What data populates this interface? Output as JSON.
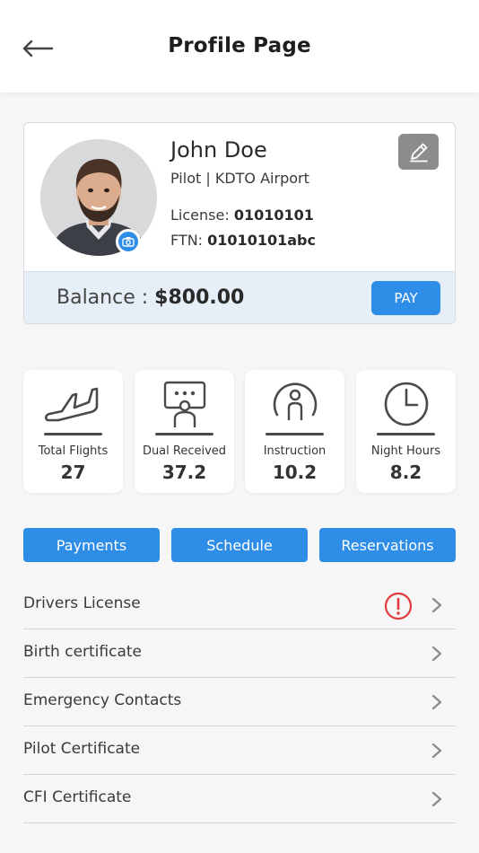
{
  "header": {
    "title": "Profile Page",
    "back_icon": "back-arrow-icon"
  },
  "profile": {
    "name": "John Doe",
    "role": "Pilot |",
    "airport": "KDTO Airport",
    "license_label": "License:",
    "license_value": "01010101",
    "ftn_label": "FTN:",
    "ftn_value": "01010101abc",
    "balance_label": "Balance :",
    "balance_value": "$800.00",
    "pay_label": "PAY",
    "edit_icon": "pencil-icon",
    "camera_icon": "camera-icon"
  },
  "stats": [
    {
      "label": "Total Flights",
      "value": "27",
      "icon": "airplane-icon"
    },
    {
      "label": "Dual Received",
      "value": "37.2",
      "icon": "presentation-icon"
    },
    {
      "label": "Instruction",
      "value": "10.2",
      "icon": "instructor-icon"
    },
    {
      "label": "Night Hours",
      "value": "8.2",
      "icon": "clock-icon"
    }
  ],
  "actions": {
    "payments": "Payments",
    "schedule": "Schedule",
    "reservations": "Reservations"
  },
  "documents": [
    {
      "label": "Drivers License",
      "alert": true
    },
    {
      "label": "Birth certificate",
      "alert": false
    },
    {
      "label": "Emergency Contacts",
      "alert": false
    },
    {
      "label": "Pilot Certificate",
      "alert": false
    },
    {
      "label": "CFI Certificate",
      "alert": false
    }
  ],
  "colors": {
    "accent": "#2e8de6",
    "alert": "#e0393e",
    "edit_button": "#8c8c8e",
    "balance_bg": "#e6eff7"
  }
}
